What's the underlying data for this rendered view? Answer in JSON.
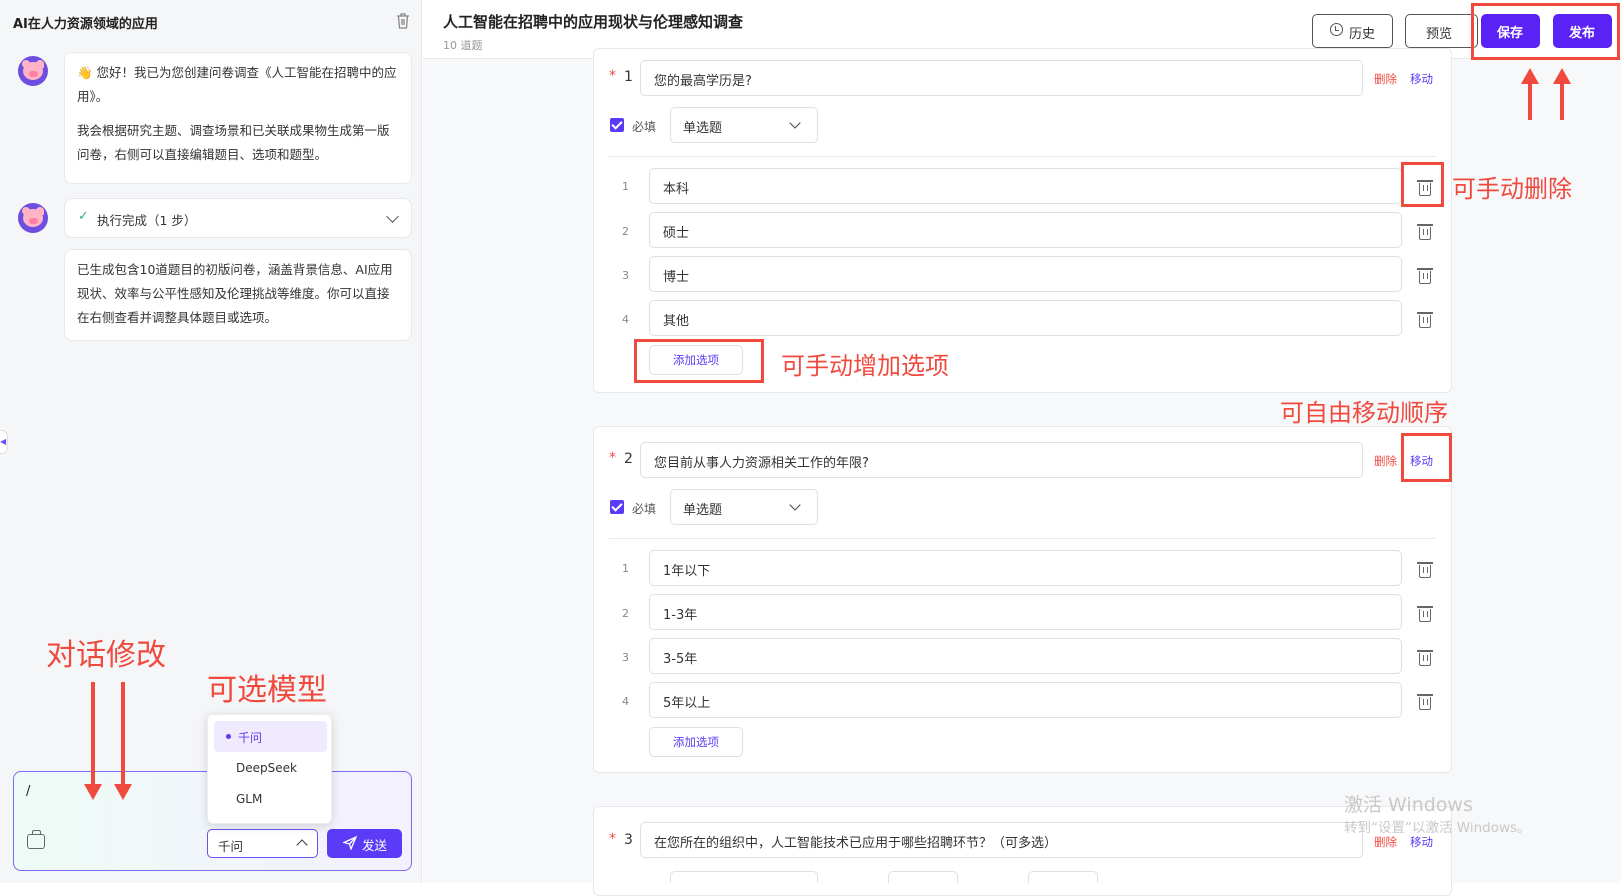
{
  "left_panel": {
    "title": "AI在人力资源领域的应用",
    "greeting": "👋 您好！我已为您创建问卷调查《人工智能在招聘中的应用》。",
    "greeting_detail": "我会根据研究主题、调查场景和已关联成果物生成第一版问卷，右侧可以直接编辑题目、选项和题型。",
    "exec_status": "执行完成（1 步）",
    "result": "已生成包含10道题目的初版问卷，涵盖背景信息、AI应用现状、效率与公平性感知及伦理挑战等维度。你可以直接在右侧查看并调整具体题目或选项。",
    "input_value": "/",
    "model_selected": "千问",
    "model_options": [
      "千问",
      "DeepSeek",
      "GLM"
    ],
    "send_label": "发送",
    "icons": {
      "delete": "trash-icon",
      "avatar": "pig-avatar-icon",
      "check": "check-icon",
      "toolbox": "toolbox-icon",
      "send": "send-icon"
    }
  },
  "header": {
    "title": "人工智能在招聘中的应用现状与伦理感知调查",
    "subtitle": "10 道题",
    "history_label": "历史",
    "preview_label": "预览",
    "save_label": "保存",
    "publish_label": "发布"
  },
  "question_common": {
    "required_label": "必填",
    "delete_label": "删除",
    "move_label": "移动",
    "add_option_label": "添加选项"
  },
  "questions": [
    {
      "number": "1",
      "text": "您的最高学历是?",
      "type": "单选题",
      "options": [
        "本科",
        "硕士",
        "博士",
        "其他"
      ]
    },
    {
      "number": "2",
      "text": "您目前从事人力资源相关工作的年限?",
      "type": "单选题",
      "options": [
        "1年以下",
        "1-3年",
        "3-5年",
        "5年以上"
      ]
    },
    {
      "number": "3",
      "text": "在您所在的组织中，人工智能技术已应用于哪些招聘环节？（可多选）"
    }
  ],
  "annotations": {
    "manual_delete": "可手动删除",
    "manual_add": "可手动增加选项",
    "free_move": "可自由移动顺序",
    "chat_edit": "对话修改",
    "select_model": "可选模型"
  },
  "watermark": {
    "line1": "激活 Windows",
    "line2": "转到“设置”以激活 Windows。"
  },
  "colors": {
    "accent": "#5b3bf5",
    "annotation": "#f04a3f",
    "delete": "#f04a3f"
  }
}
